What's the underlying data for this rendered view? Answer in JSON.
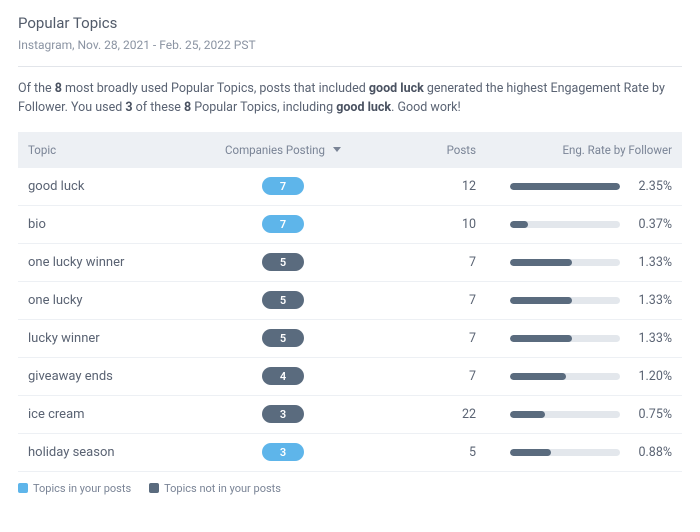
{
  "header": {
    "title": "Popular Topics",
    "subtitle": "Instagram, Nov. 28, 2021 - Feb. 25, 2022 PST"
  },
  "summary": {
    "pre": "Of the ",
    "total": "8",
    "mid1": " most broadly used Popular Topics, posts that included ",
    "top_topic": "good luck",
    "mid2": " generated the highest Engagement Rate by Follower. You used ",
    "used": "3",
    "mid3": " of these ",
    "total2": "8",
    "mid4": " Popular Topics, including ",
    "top_topic2": "good luck",
    "tail": ". Good work!"
  },
  "columns": {
    "topic": "Topic",
    "companies": "Companies Posting",
    "posts": "Posts",
    "eng": "Eng. Rate by Follower"
  },
  "rows": [
    {
      "topic": "good luck",
      "companies": "7",
      "in_posts": true,
      "posts": "12",
      "eng_rate": "2.35%",
      "eng_fill": 100
    },
    {
      "topic": "bio",
      "companies": "7",
      "in_posts": true,
      "posts": "10",
      "eng_rate": "0.37%",
      "eng_fill": 16
    },
    {
      "topic": "one lucky winner",
      "companies": "5",
      "in_posts": false,
      "posts": "7",
      "eng_rate": "1.33%",
      "eng_fill": 56
    },
    {
      "topic": "one lucky",
      "companies": "5",
      "in_posts": false,
      "posts": "7",
      "eng_rate": "1.33%",
      "eng_fill": 56
    },
    {
      "topic": "lucky winner",
      "companies": "5",
      "in_posts": false,
      "posts": "7",
      "eng_rate": "1.33%",
      "eng_fill": 56
    },
    {
      "topic": "giveaway ends",
      "companies": "4",
      "in_posts": false,
      "posts": "7",
      "eng_rate": "1.20%",
      "eng_fill": 51
    },
    {
      "topic": "ice cream",
      "companies": "3",
      "in_posts": false,
      "posts": "22",
      "eng_rate": "0.75%",
      "eng_fill": 32
    },
    {
      "topic": "holiday season",
      "companies": "3",
      "in_posts": true,
      "posts": "5",
      "eng_rate": "0.88%",
      "eng_fill": 37
    }
  ],
  "legend": {
    "in": "Topics in your posts",
    "out": "Topics not in your posts"
  }
}
